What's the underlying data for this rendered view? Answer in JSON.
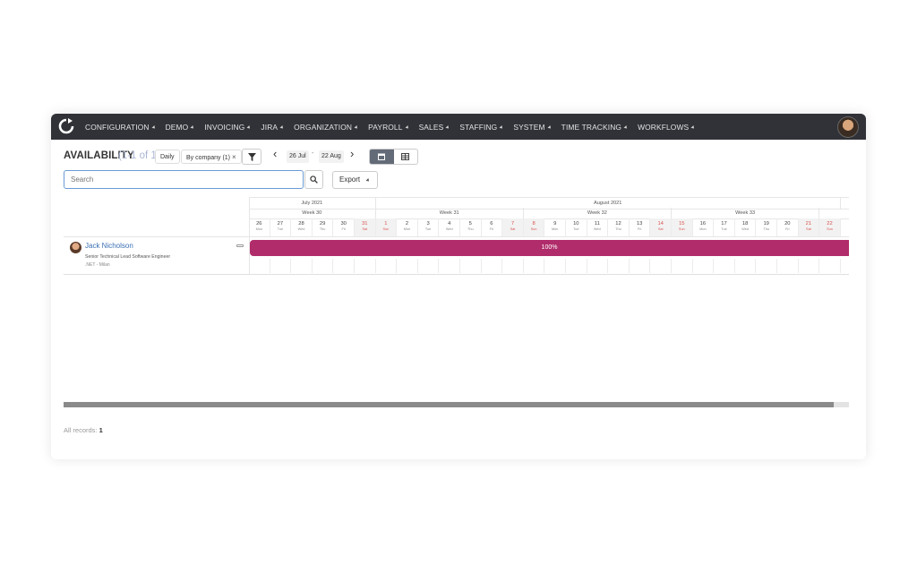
{
  "menu": [
    {
      "label": "CONFIGURATION"
    },
    {
      "label": "DEMO"
    },
    {
      "label": "INVOICING"
    },
    {
      "label": "JIRA"
    },
    {
      "label": "ORGANIZATION"
    },
    {
      "label": "PAYROLL"
    },
    {
      "label": "SALES"
    },
    {
      "label": "STAFFING"
    },
    {
      "label": "SYSTEM"
    },
    {
      "label": "TIME TRACKING"
    },
    {
      "label": "WORKFLOWS"
    }
  ],
  "toolbar": {
    "title": "AVAILABILITY",
    "count": "(1-1 of 1)",
    "mode_label": "Daily",
    "group_label": "By company (1)",
    "group_remove": "×",
    "date_from": "26 Jul",
    "date_sep": "-",
    "date_to": "22 Aug",
    "prev_arrow": "‹",
    "next_arrow": "›"
  },
  "search": {
    "placeholder": "Search"
  },
  "export": {
    "label": "Export"
  },
  "months": [
    {
      "label": "July 2021",
      "days": 6
    },
    {
      "label": "August 2021",
      "days": 22
    }
  ],
  "weeks": [
    {
      "label": "Week 30",
      "days": 6
    },
    {
      "label": "Week 31",
      "days": 7
    },
    {
      "label": "Week 32",
      "days": 7
    },
    {
      "label": "Week 33",
      "days": 7
    }
  ],
  "days": [
    {
      "n": "26",
      "w": "Mon"
    },
    {
      "n": "27",
      "w": "Tue"
    },
    {
      "n": "28",
      "w": "Wed"
    },
    {
      "n": "29",
      "w": "Thu"
    },
    {
      "n": "30",
      "w": "Fri"
    },
    {
      "n": "31",
      "w": "Sat",
      "we": true
    },
    {
      "n": "1",
      "w": "Sun",
      "we": true
    },
    {
      "n": "2",
      "w": "Mon"
    },
    {
      "n": "3",
      "w": "Tue"
    },
    {
      "n": "4",
      "w": "Wed"
    },
    {
      "n": "5",
      "w": "Thu"
    },
    {
      "n": "6",
      "w": "Fri"
    },
    {
      "n": "7",
      "w": "Sat",
      "we": true
    },
    {
      "n": "8",
      "w": "Sun",
      "we": true
    },
    {
      "n": "9",
      "w": "Mon"
    },
    {
      "n": "10",
      "w": "Tue"
    },
    {
      "n": "11",
      "w": "Wed"
    },
    {
      "n": "12",
      "w": "Thu"
    },
    {
      "n": "13",
      "w": "Fri"
    },
    {
      "n": "14",
      "w": "Sat",
      "we": true
    },
    {
      "n": "15",
      "w": "Sun",
      "we": true
    },
    {
      "n": "16",
      "w": "Mon"
    },
    {
      "n": "17",
      "w": "Tue"
    },
    {
      "n": "18",
      "w": "Wed"
    },
    {
      "n": "19",
      "w": "Thu"
    },
    {
      "n": "20",
      "w": "Fri"
    },
    {
      "n": "21",
      "w": "Sat",
      "we": true
    },
    {
      "n": "22",
      "w": "Sun",
      "we": true
    }
  ],
  "person": {
    "name": "Jack Nicholson",
    "role": "Senior Technical Lead Software Engineer",
    "location": ".NET - Milan",
    "availability": "100%",
    "bar_color": "#b02c6a"
  },
  "footer": {
    "records_label": "All records:",
    "records_count": "1"
  }
}
